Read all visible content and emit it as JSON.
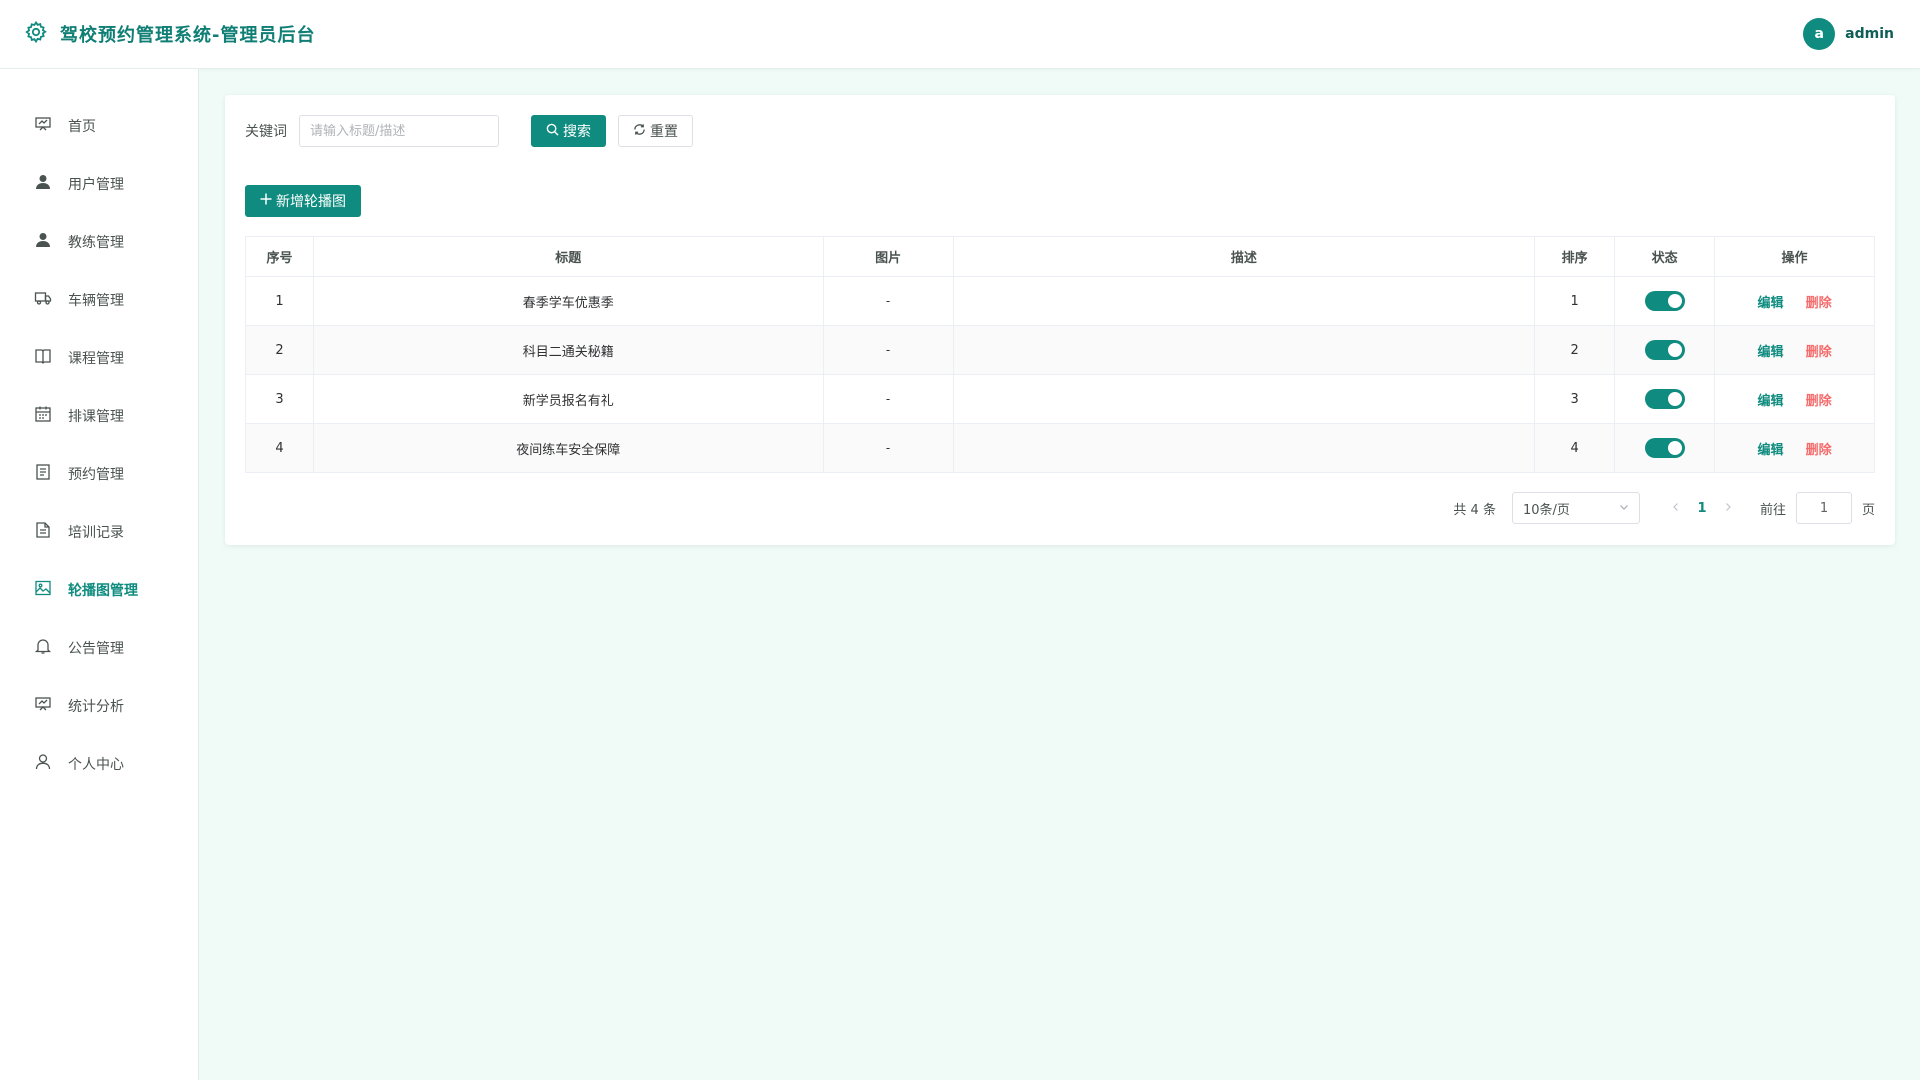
{
  "header": {
    "title": "驾校预约管理系统-管理员后台",
    "avatar_letter": "a",
    "username": "admin"
  },
  "sidebar": {
    "items": [
      {
        "label": "首页",
        "icon": "presentation-icon"
      },
      {
        "label": "用户管理",
        "icon": "user-icon"
      },
      {
        "label": "教练管理",
        "icon": "user-icon"
      },
      {
        "label": "车辆管理",
        "icon": "truck-icon"
      },
      {
        "label": "课程管理",
        "icon": "book-icon"
      },
      {
        "label": "排课管理",
        "icon": "calendar-icon"
      },
      {
        "label": "预约管理",
        "icon": "document-icon"
      },
      {
        "label": "培训记录",
        "icon": "document-icon"
      },
      {
        "label": "轮播图管理",
        "icon": "picture-icon",
        "active": true
      },
      {
        "label": "公告管理",
        "icon": "bell-icon"
      },
      {
        "label": "统计分析",
        "icon": "presentation-icon"
      },
      {
        "label": "个人中心",
        "icon": "user-outline-icon"
      }
    ]
  },
  "search": {
    "label": "关键词",
    "placeholder": "请输入标题/描述",
    "search_label": "搜索",
    "reset_label": "重置"
  },
  "add_button_label": "新增轮播图",
  "table": {
    "columns": [
      "序号",
      "标题",
      "图片",
      "描述",
      "排序",
      "状态",
      "操作"
    ],
    "rows": [
      {
        "index": "1",
        "title": "春季学车优惠季",
        "image": "-",
        "description": "",
        "sort": "1",
        "status": true
      },
      {
        "index": "2",
        "title": "科目二通关秘籍",
        "image": "-",
        "description": "",
        "sort": "2",
        "status": true
      },
      {
        "index": "3",
        "title": "新学员报名有礼",
        "image": "-",
        "description": "",
        "sort": "3",
        "status": true
      },
      {
        "index": "4",
        "title": "夜间练车安全保障",
        "image": "-",
        "description": "",
        "sort": "4",
        "status": true
      }
    ],
    "edit_label": "编辑",
    "delete_label": "删除"
  },
  "pagination": {
    "total_text": "共 4 条",
    "page_size": "10条/页",
    "current_page": "1",
    "goto_label": "前往",
    "goto_value": "1",
    "page_suffix": "页"
  },
  "colors": {
    "accent": "#0f8c7f",
    "danger": "#f56c6c",
    "background": "#f0fbf8"
  }
}
